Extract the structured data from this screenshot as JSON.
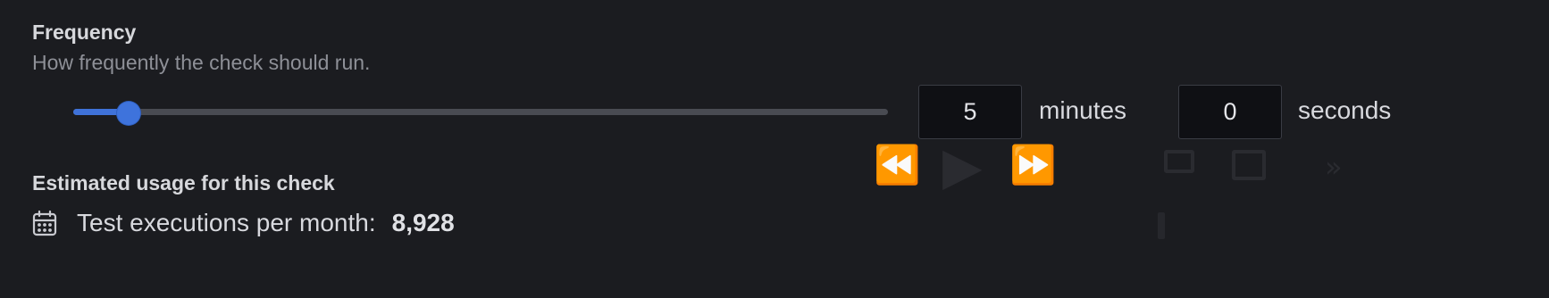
{
  "frequency": {
    "title": "Frequency",
    "description": "How frequently the check should run.",
    "slider_fraction": 0.068,
    "minutes_value": "5",
    "minutes_label": "minutes",
    "seconds_value": "0",
    "seconds_label": "seconds"
  },
  "colors": {
    "accent": "#3e73dc",
    "background": "#1b1c20"
  },
  "usage": {
    "title": "Estimated usage for this check",
    "icon": "calendar-icon",
    "label": "Test executions per month:",
    "value": "8,928"
  }
}
